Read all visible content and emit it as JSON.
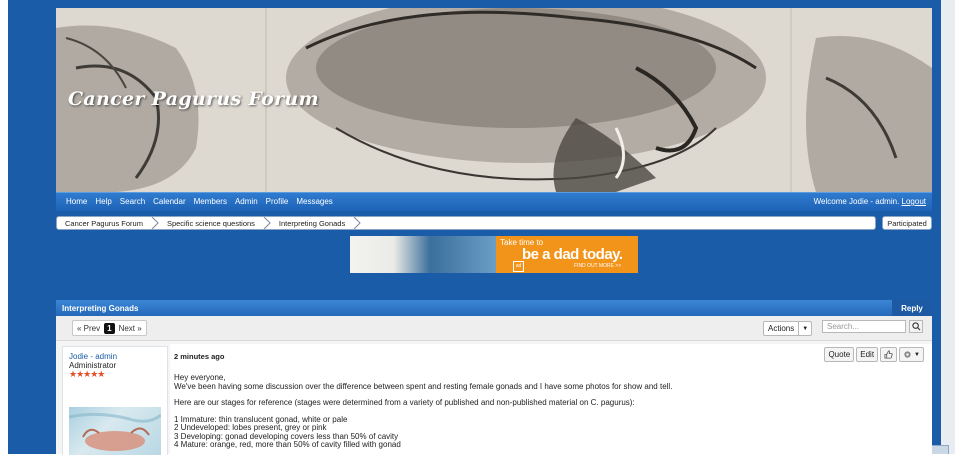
{
  "forum": {
    "title": "Cancer Pagurus Forum"
  },
  "nav": {
    "items": [
      "Home",
      "Help",
      "Search",
      "Calendar",
      "Members",
      "Admin",
      "Profile",
      "Messages"
    ],
    "welcome_text": "Welcome Jodie - admin.",
    "logout_label": "Logout"
  },
  "breadcrumb": {
    "items": [
      "Cancer Pagurus Forum",
      "Specific science questions",
      "Interpreting Gonads"
    ],
    "participated_label": "Participated"
  },
  "ad": {
    "line1": "Take time to",
    "line2": "be a dad today.",
    "cta": "FIND OUT MORE >>"
  },
  "thread": {
    "title": "Interpreting Gonads",
    "reply_label": "Reply"
  },
  "pager": {
    "prev_label": "« Prev",
    "current_page": "1",
    "next_label": "Next »"
  },
  "toolbar": {
    "actions_label": "Actions",
    "search_placeholder": "Search..."
  },
  "post": {
    "author": "Jodie - admin",
    "role": "Administrator",
    "stars": "★★★★★",
    "time": "2 minutes ago",
    "quote_label": "Quote",
    "edit_label": "Edit",
    "body": {
      "line1": "Hey everyone,",
      "line2": "We've been having some discussion over the difference between spent and resting female gonads and I have some photos for show and tell.",
      "line3": "Here are our stages for reference (stages were determined from a variety of published and non-published material on C. pagurus):",
      "stage1": "1 Immature: thin translucent gonad, white or pale",
      "stage2": "2 Undeveloped: lobes present, grey or pink",
      "stage3": "3 Developing: gonad developing covers less than 50% of cavity",
      "stage4": "4 Mature: orange, red, more than 50% of cavity filled with gonad"
    }
  },
  "colors": {
    "page_blue": "#1a5ca8",
    "nav_blue": "#2468b8",
    "ad_orange": "#f29419",
    "link_blue": "#1a5ca8",
    "star_red": "#e2502a"
  }
}
